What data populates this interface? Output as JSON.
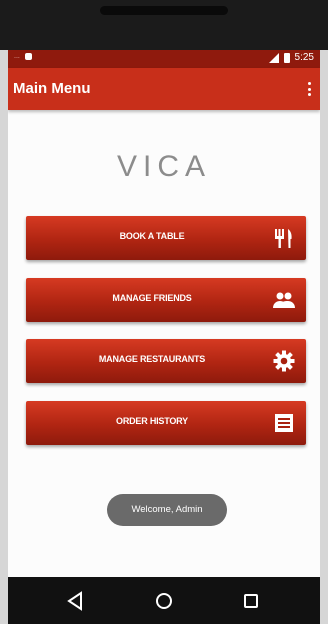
{
  "status_bar": {
    "carrier": "...",
    "time": "5:25"
  },
  "app_bar": {
    "title": "Main Menu"
  },
  "logo": {
    "text": "VICA"
  },
  "menu": {
    "items": [
      {
        "label": "BOOK A TABLE",
        "icon": "fork-knife-icon"
      },
      {
        "label": "MANAGE FRIENDS",
        "icon": "friends-icon"
      },
      {
        "label": "MANAGE RESTAURANTS",
        "icon": "gear-icon"
      },
      {
        "label": "ORDER HISTORY",
        "icon": "list-icon"
      }
    ]
  },
  "toast": {
    "text": "Welcome, Admin"
  },
  "colors": {
    "status_bar": "#8f1a0d",
    "app_bar": "#c82f1a",
    "button_gradient_top": "#d63a22",
    "button_gradient_bottom": "#8e1a0c",
    "toast": "#6a6a6a",
    "nav_bar": "#111111"
  },
  "nav": {
    "items": [
      {
        "icon": "back-icon"
      },
      {
        "icon": "home-icon"
      },
      {
        "icon": "recents-icon"
      }
    ]
  }
}
